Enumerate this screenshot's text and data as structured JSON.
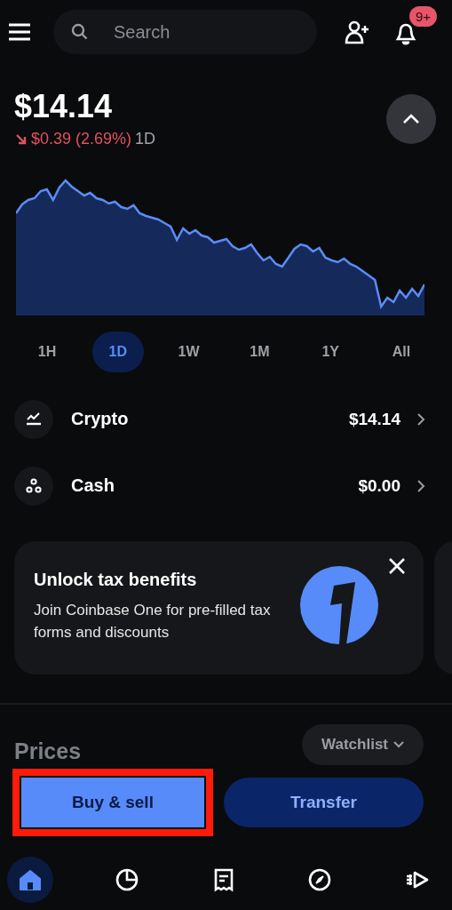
{
  "top_bar": {
    "search": {
      "placeholder": "Search"
    },
    "notifications_badge": "9+"
  },
  "balance": {
    "amount": "$14.14",
    "change": "$0.39 (2.69%)",
    "falling": true,
    "period": "1D"
  },
  "ranges": [
    {
      "label": "1H",
      "selected": false
    },
    {
      "label": "1D",
      "selected": true
    },
    {
      "label": "1W",
      "selected": false
    },
    {
      "label": "1M",
      "selected": false
    },
    {
      "label": "1Y",
      "selected": false
    },
    {
      "label": "All",
      "selected": false
    }
  ],
  "accounts": [
    {
      "kind": "crypto",
      "name": "Crypto",
      "value": "$14.14"
    },
    {
      "kind": "cash",
      "name": "Cash",
      "value": "$0.00"
    }
  ],
  "promo": {
    "title": "Unlock tax benefits",
    "text": "Join Coinbase One for pre-filled tax forms and discounts"
  },
  "prices": {
    "title": "Prices",
    "filter": "Watchlist"
  },
  "actions": [
    {
      "label": "Buy & sell",
      "kind": "primary",
      "highlighted": true
    },
    {
      "label": "Transfer",
      "kind": "secondary",
      "highlighted": false
    }
  ],
  "nav": [
    {
      "kind": "home",
      "selected": true
    },
    {
      "kind": "portfolio",
      "selected": false
    },
    {
      "kind": "orders",
      "selected": false
    },
    {
      "kind": "explore",
      "selected": false
    },
    {
      "kind": "trade",
      "selected": false
    }
  ]
}
